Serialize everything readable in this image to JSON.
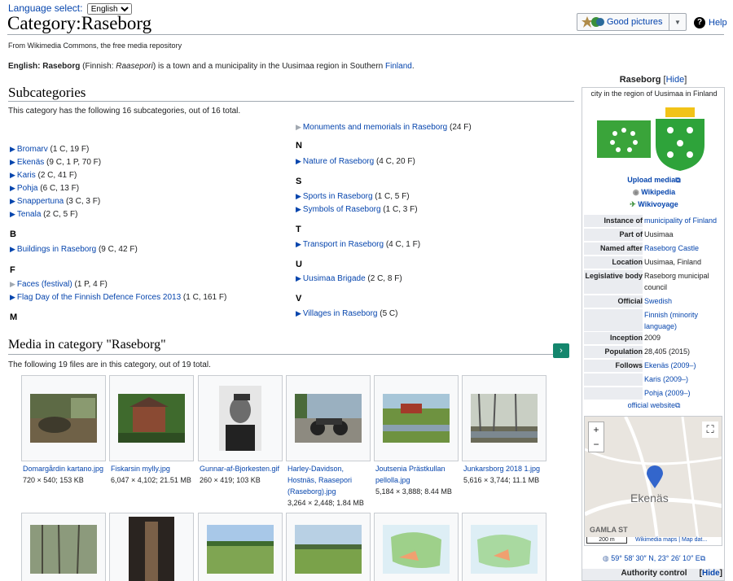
{
  "lang": {
    "label": "Language select:",
    "value": "English"
  },
  "page": {
    "title": "Category:Raseborg",
    "from": "From Wikimedia Commons, the free media repository"
  },
  "toolbar": {
    "good_pictures": "Good pictures",
    "help": "Help"
  },
  "desc": {
    "lang": "English:",
    "name": "Raseborg",
    "rest1": " (Finnish: ",
    "fi": "Raasepori",
    "rest2": ") is a town and a municipality in the Uusimaa region in Southern ",
    "link": "Finland",
    "end": "."
  },
  "subcategories": {
    "heading": "Subcategories",
    "count": "This category has the following 16 subcategories, out of 16 total.",
    "left": [
      {
        "name": "Bromarv",
        "count": " (1 C, 19 F)"
      },
      {
        "name": "Ekenäs",
        "count": " (9 C, 1 P, 70 F)"
      },
      {
        "name": "Karis",
        "count": " (2 C, 41 F)"
      },
      {
        "name": "Pohja",
        "count": " (6 C, 13 F)"
      },
      {
        "name": "Snappertuna",
        "count": " (3 C, 3 F)"
      },
      {
        "name": "Tenala",
        "count": " (2 C, 5 F)"
      },
      {
        "letter": "B"
      },
      {
        "name": "Buildings in Raseborg",
        "count": " (9 C, 42 F)"
      },
      {
        "letter": "F"
      },
      {
        "name": "Faces (festival)",
        "count": " (1 P, 4 F)"
      },
      {
        "name": "Flag Day of the Finnish Defence Forces 2013",
        "count": " (1 C, 161 F)"
      },
      {
        "letter": "M"
      }
    ],
    "right": [
      {
        "name": "Monuments and memorials in Raseborg",
        "count": " (24 F)"
      },
      {
        "letter": "N"
      },
      {
        "name": "Nature of Raseborg",
        "count": " (4 C, 20 F)"
      },
      {
        "letter": "S"
      },
      {
        "name": "Sports in Raseborg",
        "count": " (1 C, 5 F)"
      },
      {
        "name": "Symbols of Raseborg",
        "count": " (1 C, 3 F)"
      },
      {
        "letter": "T"
      },
      {
        "name": "Transport in Raseborg",
        "count": " (4 C, 1 F)"
      },
      {
        "letter": "U"
      },
      {
        "name": "Uusimaa Brigade",
        "count": " (2 C, 8 F)"
      },
      {
        "letter": "V"
      },
      {
        "name": "Villages in Raseborg",
        "count": " (5 C)"
      }
    ]
  },
  "media": {
    "heading": "Media in category \"Raseborg\"",
    "count": "The following 19 files are in this category, out of 19 total.",
    "files": [
      {
        "name": "Domargårdin kartano.jpg",
        "info": "720 × 540; 153 KB"
      },
      {
        "name": "Fiskarsin mylly.jpg",
        "info": "6,047 × 4,102; 21.51 MB"
      },
      {
        "name": "Gunnar-af-Bjorkesten.gif",
        "info": "260 × 419; 103 KB"
      },
      {
        "name": "Harley-Davidson, Hostnäs, Raasepori (Raseborg).jpg",
        "info": "3,264 × 2,448; 1.84 MB"
      },
      {
        "name": "Joutsenia Prästkullan pellolla.jpg",
        "info": "5,184 × 3,888; 8.44 MB"
      },
      {
        "name": "Junkarsborg 2018 1.jpg",
        "info": "5,616 × 3,744; 11.1 MB"
      }
    ]
  },
  "infobox": {
    "title": "Raseborg",
    "hide": "Hide",
    "subtitle": "city in the region of Uusimaa in Finland",
    "upload": "Upload media",
    "wikipedia": "Wikipedia",
    "wikivoyage": "Wikivoyage",
    "rows": [
      {
        "k": "Instance of",
        "v": "municipality of Finland"
      },
      {
        "k": "Part of",
        "v": "Uusimaa"
      },
      {
        "k": "Named after",
        "v": "Raseborg Castle"
      },
      {
        "k": "Location",
        "v": "Uusimaa, Finland"
      },
      {
        "k": "Legislative body",
        "v": "Raseborg municipal council"
      },
      {
        "k": "Official language",
        "v": "Swedish"
      },
      {
        "k": "",
        "v": "Finnish (minority language)"
      },
      {
        "k": "Inception",
        "v": "2009"
      },
      {
        "k": "Population",
        "v": "28,405 (2015)"
      },
      {
        "k": "Follows",
        "v": "Ekenäs (2009–)"
      },
      {
        "k": "",
        "v": "Karis (2009–)"
      },
      {
        "k": "",
        "v": "Pohja (2009–)"
      }
    ],
    "website": "official website",
    "map": {
      "town": "Ekenäs",
      "street": "GAMLA ST",
      "scale": "200 m",
      "attrib": "Wikimedia maps | Map dat...",
      "coords": "59° 58′ 30″ N, 23° 26′ 10″ E"
    },
    "authority": "Authority control",
    "hide2": "Hide"
  }
}
